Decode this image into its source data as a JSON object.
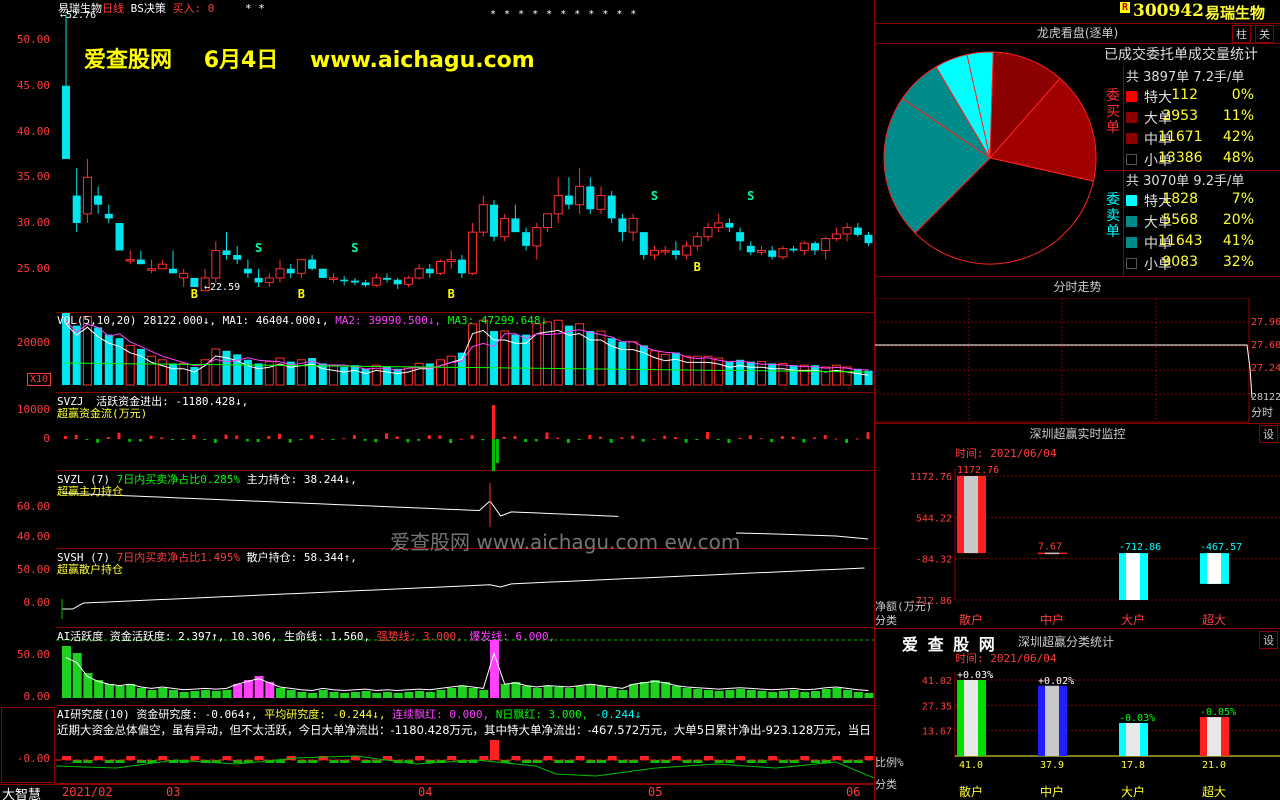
{
  "header": {
    "stock_name": "易瑞生物",
    "period": "日线",
    "strategy": "BS决策",
    "buy_label": "买入: 0",
    "stars1": "* *",
    "stars2": "* * * * * *   * *   * * *",
    "price_marker": "←52.76",
    "low_marker": "←22.59"
  },
  "watermark": {
    "site": "爱查股网",
    "date": "6月4日",
    "url": "www.aichagu.com",
    "center": "爱查股网      www.aichagu.com      ew.com"
  },
  "price_axis": [
    "50.00",
    "45.00",
    "40.00",
    "35.00",
    "30.00",
    "25.00"
  ],
  "chart_data": {
    "type": "candlestick",
    "candles": [
      [
        45,
        52.76,
        38,
        37
      ],
      [
        33,
        36,
        29,
        30
      ],
      [
        31,
        37,
        30,
        35
      ],
      [
        33,
        34,
        31,
        32
      ],
      [
        31,
        32,
        30,
        30.5
      ],
      [
        30,
        30,
        27,
        27
      ],
      [
        26,
        27,
        25.5,
        26
      ],
      [
        26,
        27,
        25.5,
        25.5
      ],
      [
        25,
        26,
        24.5,
        25
      ],
      [
        25,
        26,
        25,
        25.5
      ],
      [
        25,
        27,
        24.5,
        24.5
      ],
      [
        24,
        25,
        23,
        24.5
      ],
      [
        24,
        24,
        23,
        23
      ],
      [
        22.6,
        25,
        22.59,
        24
      ],
      [
        24,
        28,
        23.5,
        27
      ],
      [
        27,
        29,
        26,
        26.5
      ],
      [
        26.5,
        27.5,
        25.5,
        26
      ],
      [
        25,
        26,
        24,
        24.5
      ],
      [
        24,
        25,
        23,
        23.5
      ],
      [
        23.5,
        24.5,
        23,
        24
      ],
      [
        24,
        26,
        23.5,
        25
      ],
      [
        25,
        25.5,
        24,
        24.5
      ],
      [
        24.5,
        26,
        24,
        26
      ],
      [
        26,
        26.5,
        24.8,
        25
      ],
      [
        25,
        25,
        24,
        24
      ],
      [
        24,
        24.5,
        23.5,
        24
      ],
      [
        23.8,
        24.2,
        23.2,
        23.7
      ],
      [
        23.7,
        24,
        23.2,
        23.5
      ],
      [
        23.5,
        23.8,
        23,
        23.2
      ],
      [
        23.2,
        24.5,
        23,
        24
      ],
      [
        24,
        24.5,
        23.5,
        23.8
      ],
      [
        23.8,
        24,
        22.8,
        23.3
      ],
      [
        23.3,
        24.2,
        23,
        24
      ],
      [
        24,
        25.5,
        23.8,
        25
      ],
      [
        25,
        25.5,
        24,
        24.5
      ],
      [
        24.5,
        26,
        24.3,
        25.8
      ],
      [
        25.8,
        27,
        25,
        26
      ],
      [
        26,
        26.5,
        24,
        24.5
      ],
      [
        24.5,
        30,
        24.3,
        29
      ],
      [
        29,
        33,
        28.5,
        32
      ],
      [
        32,
        32.5,
        28,
        28.5
      ],
      [
        28.5,
        31,
        28,
        30.5
      ],
      [
        30.5,
        32,
        29,
        29
      ],
      [
        29,
        29.5,
        27,
        27.5
      ],
      [
        27.5,
        30,
        26,
        29.5
      ],
      [
        29.5,
        31,
        29,
        31
      ],
      [
        31,
        35,
        30,
        33
      ],
      [
        33,
        35,
        31.5,
        32
      ],
      [
        32,
        36,
        31,
        34
      ],
      [
        34,
        35,
        31,
        31.5
      ],
      [
        31.5,
        34,
        31,
        33
      ],
      [
        33,
        33.5,
        30,
        30.5
      ],
      [
        30.5,
        31,
        28,
        29
      ],
      [
        29,
        31,
        28,
        30.5
      ],
      [
        29,
        29,
        26,
        26.5
      ],
      [
        26.5,
        27.5,
        26,
        27
      ],
      [
        27,
        27.5,
        26.5,
        27
      ],
      [
        27,
        28,
        26,
        26.5
      ],
      [
        26.5,
        28,
        26,
        27.5
      ],
      [
        27.5,
        29,
        27,
        28.5
      ],
      [
        28.5,
        30,
        28,
        29.5
      ],
      [
        29.5,
        31,
        29,
        30
      ],
      [
        30,
        30.5,
        29,
        29.5
      ],
      [
        29,
        29.5,
        27,
        28
      ],
      [
        27.5,
        28,
        26.5,
        26.8
      ],
      [
        26.8,
        27.5,
        26.5,
        27
      ],
      [
        27,
        27.5,
        26,
        26.3
      ],
      [
        26.3,
        27.5,
        26,
        27.2
      ],
      [
        27.2,
        27.5,
        26.8,
        27
      ],
      [
        27,
        28,
        26.5,
        27.8
      ],
      [
        27.8,
        28,
        26.5,
        27
      ],
      [
        27,
        28.5,
        26,
        28.3
      ],
      [
        28.3,
        29.5,
        28,
        28.8
      ],
      [
        28.8,
        30,
        28,
        29.5
      ],
      [
        29.5,
        30,
        28.5,
        28.7
      ],
      [
        28.7,
        29,
        27.5,
        27.8
      ]
    ]
  },
  "vol": {
    "label": "VOL(5,10,20)",
    "v": "28122.000↓,",
    "ma1": "MA1: 46404.000↓,",
    "ma2": "MA2: 39990.500↓,",
    "ma3": "MA3: 47299.648↓",
    "axis": "20000",
    "unit": "X10"
  },
  "svzj": {
    "name": "SVZJ",
    "label": "活跃资金进出: -1180.428↓,",
    "sub": "超赢资金流(万元)",
    "axis": [
      "10000",
      "0"
    ]
  },
  "svzl": {
    "name": "SVZL",
    "n": "(7)",
    "label": "7日内买卖净占比0.285%",
    "label2": "主力持仓: 38.244↓,",
    "sub": "超赢主力持仓",
    "axis": [
      "60.00",
      "40.00"
    ]
  },
  "svsh": {
    "name": "SVSH",
    "n": "(7)",
    "label": "7日内买卖净占比1.495%",
    "label2": "散户持仓: 58.344↑,",
    "sub": "超赢散户持仓",
    "axis": [
      "50.00",
      "0.00"
    ]
  },
  "ai1": {
    "label": "AI活跃度",
    "v1": "资金活跃度: 2.397↑,",
    "v2": "10.306,",
    "v3": "生命线: 1.560,",
    "v4": "强势线: 3.000,",
    "v5": "爆发线: 6.000,",
    "axis": [
      "50.00",
      "0.00"
    ]
  },
  "ai2": {
    "label": "AI研究度(10)",
    "v1": "资金研究度: -0.064↑,",
    "v2": "平均研究度: -0.244↓,",
    "v3": "连续飘红: 0.000,",
    "v4": "N日飘红: 3.000,",
    "v5": "-0.244↓",
    "text": "近期大资金总体偏空，虽有异动，但不太活跃，今日大单净流出：-1180.428万元，其中特大单净流出：-467.572万元，大单5日累计净出-923.128万元，当日",
    "axis": "-0.00"
  },
  "bottom": {
    "brand": "大智慧",
    "dates": [
      "2021/02",
      "03",
      "04",
      "05",
      "06"
    ]
  },
  "right": {
    "code": "300942",
    "name": "易瑞生物",
    "r_badge": "R",
    "btn1": "柱",
    "btn2": "关",
    "lh_title": "龙虎看盘(逐单)",
    "stats_title": "已成交委托单成交量统计",
    "buy": {
      "header": "共 3897单 7.2手/单",
      "side": "委买单",
      "rows": [
        [
          "特大",
          "112",
          "0%"
        ],
        [
          "大单",
          "2953",
          "11%"
        ],
        [
          "中单",
          "11671",
          "42%"
        ],
        [
          "小单",
          "13386",
          "48%"
        ]
      ],
      "colors": [
        "#ff0000",
        "#8b0000",
        "#8b0000",
        "#000000"
      ]
    },
    "sell": {
      "header": "共 3070单 9.2手/单",
      "side": "委卖单",
      "rows": [
        [
          "特大",
          "1828",
          "7%"
        ],
        [
          "大单",
          "5568",
          "20%"
        ],
        [
          "中单",
          "11643",
          "41%"
        ],
        [
          "小单",
          "9083",
          "32%"
        ]
      ],
      "colors": [
        "#00ffff",
        "#008b8b",
        "#008b8b",
        "#000000"
      ]
    },
    "pie": [
      [
        "sell-xl",
        4
      ],
      [
        "sell-l",
        16
      ],
      [
        "sell-m",
        30
      ],
      [
        "sell-s",
        0
      ],
      [
        "buy-s",
        24
      ],
      [
        "buy-m",
        20
      ],
      [
        "buy-l",
        6
      ]
    ],
    "fs_title": "分时走势",
    "fs_axis": [
      "27.96",
      "27.60",
      "27.24"
    ],
    "fs_vol": "28122",
    "fs_unit": "分时",
    "mon_title": "深圳超赢实时监控",
    "mon_btn": "设",
    "mon_time": "时间: 2021/06/04",
    "mon_axis": [
      "1172.76",
      "544.22",
      "-84.32",
      "-712.86"
    ],
    "mon_unit": "净额(万元)",
    "mon_cat": "分类",
    "mon_bars": [
      [
        "散户",
        "1172.76"
      ],
      [
        "中户",
        "7.67"
      ],
      [
        "大户",
        "-712.86"
      ],
      [
        "超大",
        "-467.57"
      ]
    ],
    "cls_brand": "爱 查 股 网",
    "cls_title": "深圳超赢分类统计",
    "cls_btn": "设",
    "cls_time": "时间: 2021/06/04",
    "cls_axis": [
      "41.02",
      "27.35",
      "13.67"
    ],
    "cls_unit": "比例%",
    "cls_cat": "分类",
    "cls_bars": [
      [
        "散户",
        "41.0",
        "+0.03%"
      ],
      [
        "中户",
        "37.9",
        "+0.02%"
      ],
      [
        "大户",
        "17.8",
        "-0.03%"
      ],
      [
        "超大",
        "21.0",
        "-0.05%"
      ]
    ]
  }
}
